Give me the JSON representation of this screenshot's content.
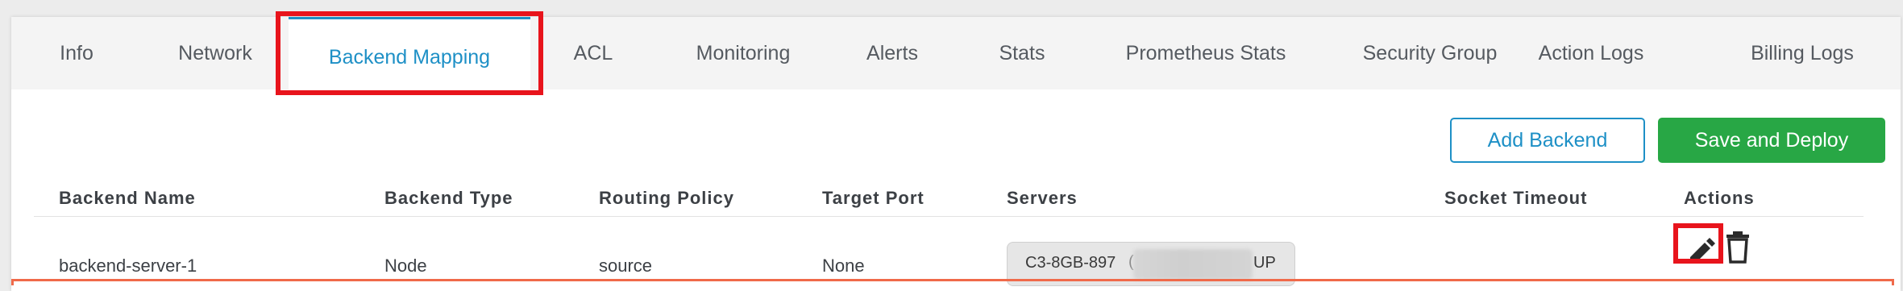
{
  "tabs": [
    {
      "label": "Info"
    },
    {
      "label": "Network"
    },
    {
      "label": "Backend Mapping",
      "active": true
    },
    {
      "label": "ACL"
    },
    {
      "label": "Monitoring"
    },
    {
      "label": "Alerts"
    },
    {
      "label": "Stats"
    },
    {
      "label": "Prometheus Stats"
    },
    {
      "label": "Security Group"
    },
    {
      "label": "Action Logs"
    },
    {
      "label": "Billing Logs"
    }
  ],
  "toolbar": {
    "add_backend_label": "Add Backend",
    "save_deploy_label": "Save and Deploy"
  },
  "table": {
    "columns": [
      "Backend Name",
      "Backend Type",
      "Routing Policy",
      "Target Port",
      "Servers",
      "Socket Timeout",
      "Actions"
    ],
    "rows": [
      {
        "backend_name": "backend-server-1",
        "backend_type": "Node",
        "routing_policy": "source",
        "target_port": "None",
        "server_name": "C3-8GB-897",
        "server_paren": "(",
        "server_status": "UP",
        "socket_timeout": ""
      }
    ]
  },
  "icons": {
    "edit": "pencil-icon",
    "delete": "trash-icon"
  },
  "colors": {
    "accent": "#1e90c6",
    "primary_action": "#28a745",
    "highlight": "#e8141c"
  }
}
